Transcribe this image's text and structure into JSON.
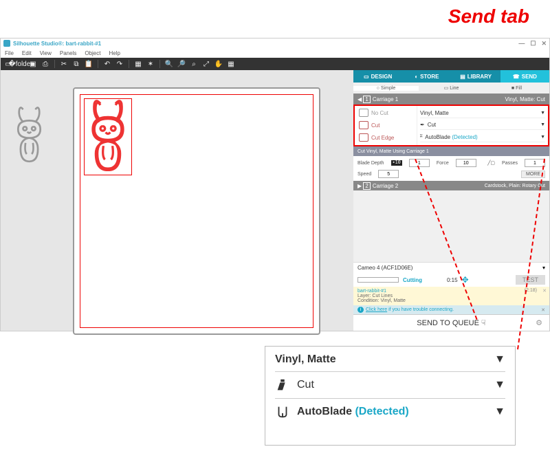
{
  "annotation": {
    "title": "Send tab"
  },
  "titlebar": {
    "text": "Silhouette Studio®: bart-rabbit-#1"
  },
  "window": {
    "min": "—",
    "max": "☐",
    "close": "✕"
  },
  "menubar": [
    "File",
    "Edit",
    "View",
    "Panels",
    "Object",
    "Help"
  ],
  "top_tabs": {
    "design": "DESIGN",
    "store": "STORE",
    "library": "LIBRARY",
    "send": "SEND"
  },
  "subtabs": {
    "simple": "Simple",
    "line": "Line",
    "fill": "Fill"
  },
  "carriage1": {
    "label": "Carriage 1",
    "material": "Vinyl, Matte: Cut"
  },
  "cut_options": {
    "nocut": "No Cut",
    "cut": "Cut",
    "cutedge": "Cut Edge"
  },
  "dropdowns": {
    "material": "Vinyl, Matte",
    "action": "Cut",
    "tool": "AutoBlade",
    "detected": "(Detected)"
  },
  "params_hdr": "Cut Vinyl, Matte Using Carriage 1",
  "params": {
    "blade_depth_label": "Blade Depth",
    "blade_depth": "1",
    "force_label": "Force",
    "force": "10",
    "passes_label": "Passes",
    "passes": "1",
    "speed_label": "Speed",
    "speed": "5",
    "more": "MORE"
  },
  "carriage2": {
    "label": "Carriage 2",
    "material": "Cardstock, Plain: Rotary Cut"
  },
  "device": {
    "name": "Cameo 4 (ACF1D06E)"
  },
  "progress": {
    "status": "Cutting",
    "time": "0:15",
    "test": "TEST"
  },
  "job": {
    "title": "bart-rabbit-#1",
    "layer": "Layer: Cut Lines",
    "condition": "Condition: Vinyl, Matte",
    "remaining": "(2:18)"
  },
  "help": {
    "prefix": "Click here",
    "text": " if you have trouble connecting."
  },
  "send_btn": "SEND TO QUEUE",
  "callout": {
    "material": "Vinyl, Matte",
    "action": "Cut",
    "tool": "AutoBlade",
    "detected": "(Detected)"
  }
}
